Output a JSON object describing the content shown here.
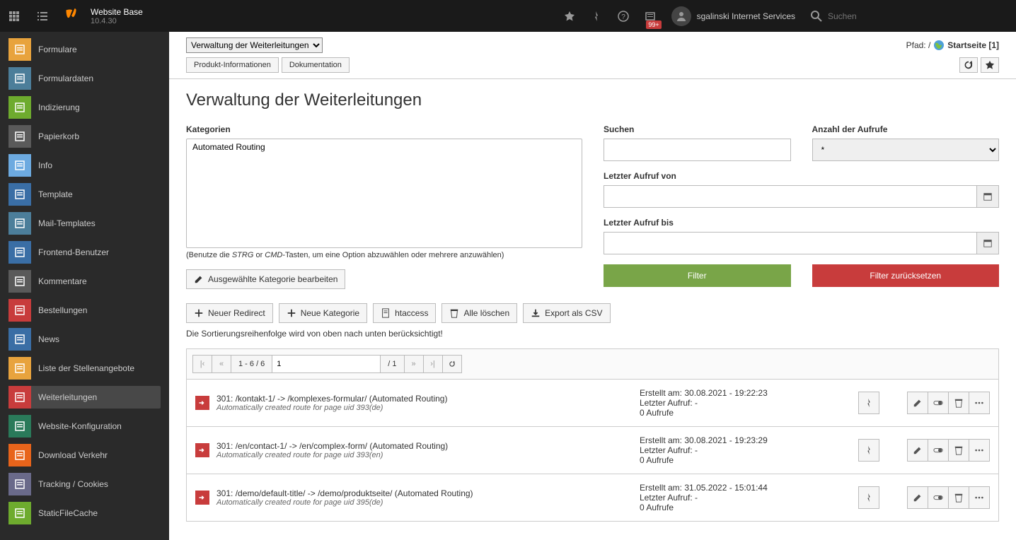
{
  "topbar": {
    "site_title": "Website Base",
    "version": "10.4.30",
    "badge": "99+",
    "username": "sgalinski Internet Services",
    "search_placeholder": "Suchen"
  },
  "sidebar": {
    "items": [
      {
        "label": "Formulare",
        "color": "#e8a33d"
      },
      {
        "label": "Formulardaten",
        "color": "#4c7e9a"
      },
      {
        "label": "Indizierung",
        "color": "#6eab2e"
      },
      {
        "label": "Papierkorb",
        "color": "#5a5a5a"
      },
      {
        "label": "Info",
        "color": "#6daae0"
      },
      {
        "label": "Template",
        "color": "#3a6ea5"
      },
      {
        "label": "Mail-Templates",
        "color": "#4c7e9a"
      },
      {
        "label": "Frontend-Benutzer",
        "color": "#3a6ea5"
      },
      {
        "label": "Kommentare",
        "color": "#5a5a5a"
      },
      {
        "label": "Bestellungen",
        "color": "#c83c3c"
      },
      {
        "label": "News",
        "color": "#3a6ea5"
      },
      {
        "label": "Liste der Stellenangebote",
        "color": "#e8a33d"
      },
      {
        "label": "Weiterleitungen",
        "color": "#c83c3c"
      },
      {
        "label": "Website-Konfiguration",
        "color": "#2a7a5a"
      },
      {
        "label": "Download Verkehr",
        "color": "#e8641b"
      },
      {
        "label": "Tracking / Cookies",
        "color": "#6a6a8a"
      },
      {
        "label": "StaticFileCache",
        "color": "#6eab2e"
      }
    ],
    "active_index": 12
  },
  "docheader": {
    "module_select": "Verwaltung der Weiterleitungen",
    "tabs": [
      "Produkt-Informationen",
      "Dokumentation"
    ],
    "path_label": "Pfad: /",
    "path_page": "Startseite [1]"
  },
  "page": {
    "title": "Verwaltung der Weiterleitungen"
  },
  "filters": {
    "categories_label": "Kategorien",
    "categories_options": [
      "Automated Routing"
    ],
    "categories_hint_pre": "(Benutze die ",
    "categories_hint_key1": "STRG",
    "categories_hint_mid": " or ",
    "categories_hint_key2": "CMD",
    "categories_hint_post": "-Tasten, um eine Option abzuwählen oder mehrere anzuwählen)",
    "edit_category_btn": "Ausgewählte Kategorie bearbeiten",
    "search_label": "Suchen",
    "hits_label": "Anzahl der Aufrufe",
    "hits_value": "*",
    "last_from_label": "Letzter Aufruf von",
    "last_to_label": "Letzter Aufruf bis",
    "filter_btn": "Filter",
    "reset_btn": "Filter zurücksetzen"
  },
  "toolbar": {
    "new_redirect": "Neuer Redirect",
    "new_category": "Neue Kategorie",
    "htaccess": "htaccess",
    "delete_all": "Alle löschen",
    "export_csv": "Export als CSV"
  },
  "note": "Die Sortierungsreihenfolge wird von oben nach unten berücksichtigt!",
  "pager": {
    "range": "1 - 6 / 6",
    "page_input": "1",
    "total": "/ 1"
  },
  "rows": [
    {
      "title": "301: /kontakt-1/ -> /komplexes-formular/ (Automated Routing)",
      "sub": "Automatically created route for page uid 393(de)",
      "created": "Erstellt am: 30.08.2021 - 19:22:23",
      "last": "Letzter Aufruf: -",
      "hits": "0 Aufrufe"
    },
    {
      "title": "301: /en/contact-1/ -> /en/complex-form/ (Automated Routing)",
      "sub": "Automatically created route for page uid 393(en)",
      "created": "Erstellt am: 30.08.2021 - 19:23:29",
      "last": "Letzter Aufruf: -",
      "hits": "0 Aufrufe"
    },
    {
      "title": "301: /demo/default-title/ -> /demo/produktseite/ (Automated Routing)",
      "sub": "Automatically created route for page uid 395(de)",
      "created": "Erstellt am: 31.05.2022 - 15:01:44",
      "last": "Letzter Aufruf: -",
      "hits": "0 Aufrufe"
    }
  ]
}
